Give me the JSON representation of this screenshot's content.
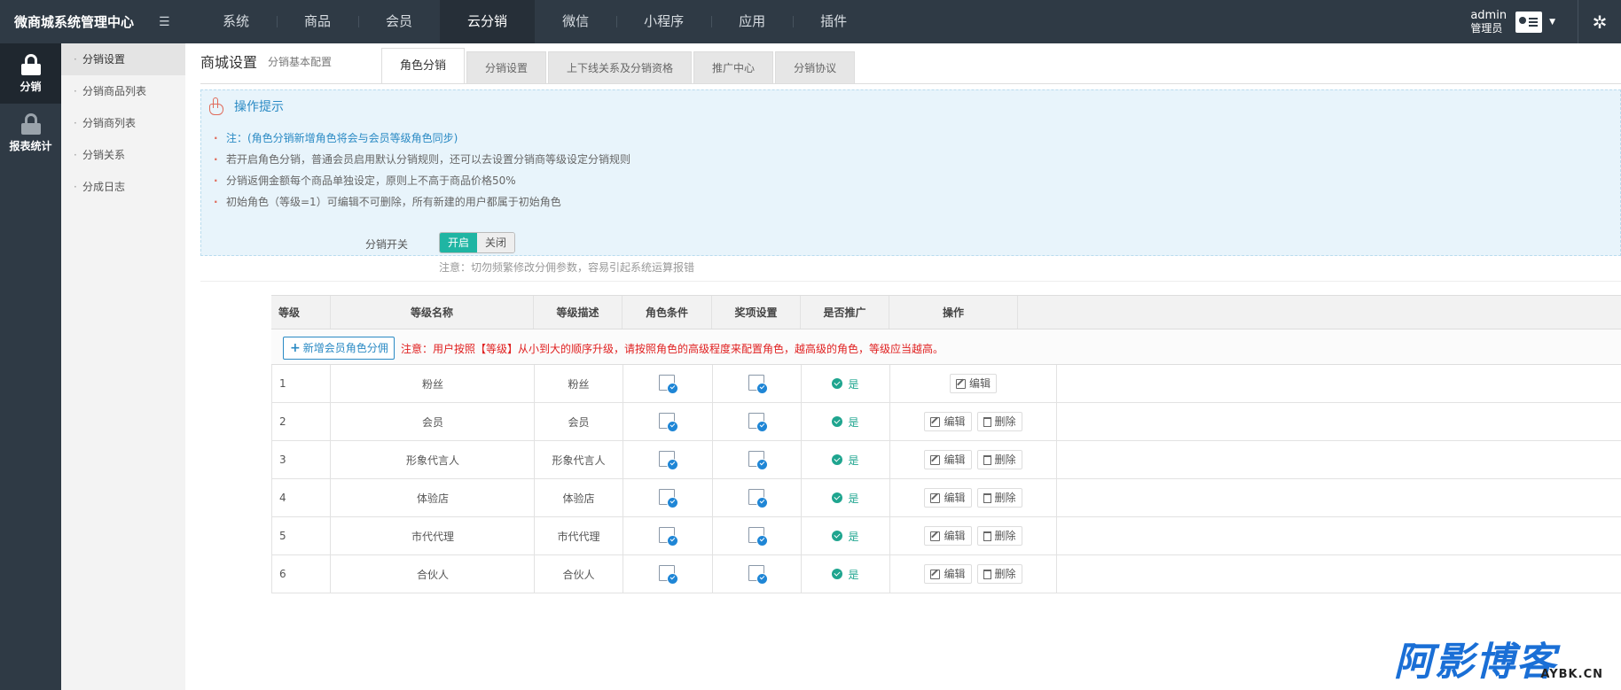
{
  "topbar": {
    "brand": "微商城系统管理中心",
    "nav": [
      "系统",
      "商品",
      "会员",
      "云分销",
      "微信",
      "小程序",
      "应用",
      "插件"
    ],
    "active_nav": "云分销",
    "user_name": "admin",
    "user_role": "管理员"
  },
  "sidebar": [
    {
      "label": "分销",
      "icon": "lock-icon",
      "active": true
    },
    {
      "label": "报表统计",
      "icon": "lock-icon",
      "active": false
    }
  ],
  "submenu": [
    "分销设置",
    "分销商品列表",
    "分销商列表",
    "分销关系",
    "分成日志"
  ],
  "page": {
    "title": "商城设置",
    "subtitle": "分销基本配置",
    "tabs": [
      "角色分销",
      "分销设置",
      "上下线关系及分销资格",
      "推广中心",
      "分销协议"
    ]
  },
  "tips": {
    "title": "操作提示",
    "items": [
      "注：(角色分销新增角色将会与会员等级角色同步)",
      "若开启角色分销，普通会员启用默认分销规则，还可以去设置分销商等级设定分销规则",
      "分销返佣金额每个商品单独设定，原则上不高于商品价格50%",
      "初始角色（等级=1）可编辑不可删除，所有新建的用户都属于初始角色"
    ]
  },
  "switch": {
    "label": "分销开关",
    "on": "开启",
    "off": "关闭",
    "note": "注意：切勿频繁修改分佣参数，容易引起系统运算报错"
  },
  "table": {
    "headers": [
      "等级",
      "等级名称",
      "等级描述",
      "角色条件",
      "奖项设置",
      "是否推广",
      "操作"
    ],
    "add_button": "新增会员角色分佣",
    "add_note": "注意：用户按照【等级】从小到大的顺序升级，请按照角色的高级程度来配置角色，越高级的角色，等级应当越高。",
    "yes_label": "是",
    "edit_label": "编辑",
    "delete_label": "删除",
    "rows": [
      {
        "level": "1",
        "name": "粉丝",
        "desc": "粉丝"
      },
      {
        "level": "2",
        "name": "会员",
        "desc": "会员"
      },
      {
        "level": "3",
        "name": "形象代言人",
        "desc": "形象代言人"
      },
      {
        "level": "4",
        "name": "体验店",
        "desc": "体验店"
      },
      {
        "level": "5",
        "name": "市代代理",
        "desc": "市代代理"
      },
      {
        "level": "6",
        "name": "合伙人",
        "desc": "合伙人"
      }
    ]
  },
  "watermark": {
    "big": "阿影博客",
    "small": "AYBK.CN"
  }
}
